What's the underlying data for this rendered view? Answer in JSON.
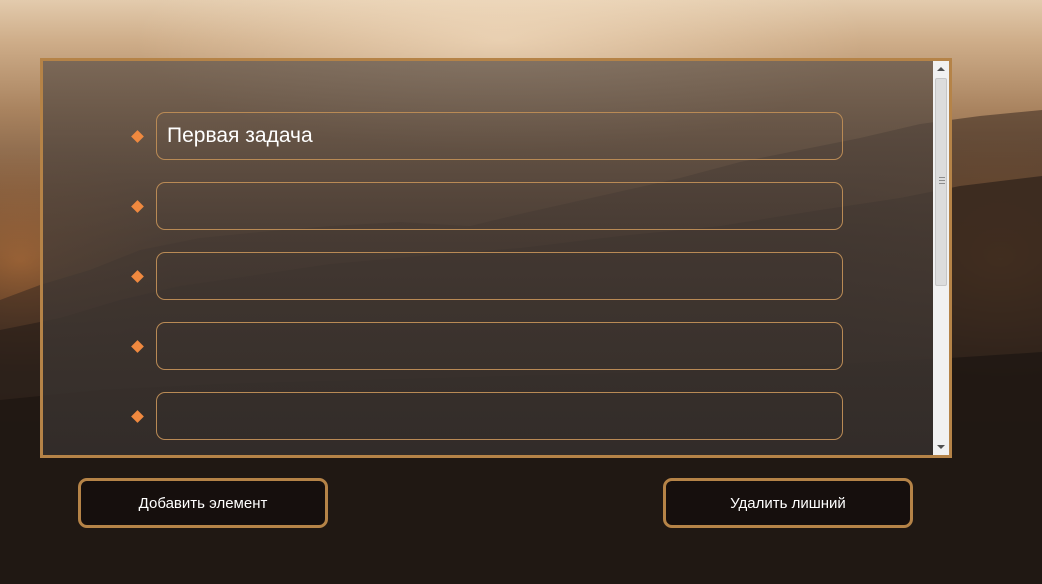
{
  "list": {
    "items": [
      {
        "value": "Первая задача"
      },
      {
        "value": ""
      },
      {
        "value": ""
      },
      {
        "value": ""
      },
      {
        "value": ""
      }
    ]
  },
  "buttons": {
    "add_label": "Добавить элемент",
    "remove_label": "Удалить лишний"
  },
  "colors": {
    "accent": "#b58347",
    "bullet": "#f0893f"
  },
  "icons": {
    "bullet": "diamond-bullet-icon",
    "scroll_up": "arrow-up-icon",
    "scroll_down": "arrow-down-icon"
  }
}
